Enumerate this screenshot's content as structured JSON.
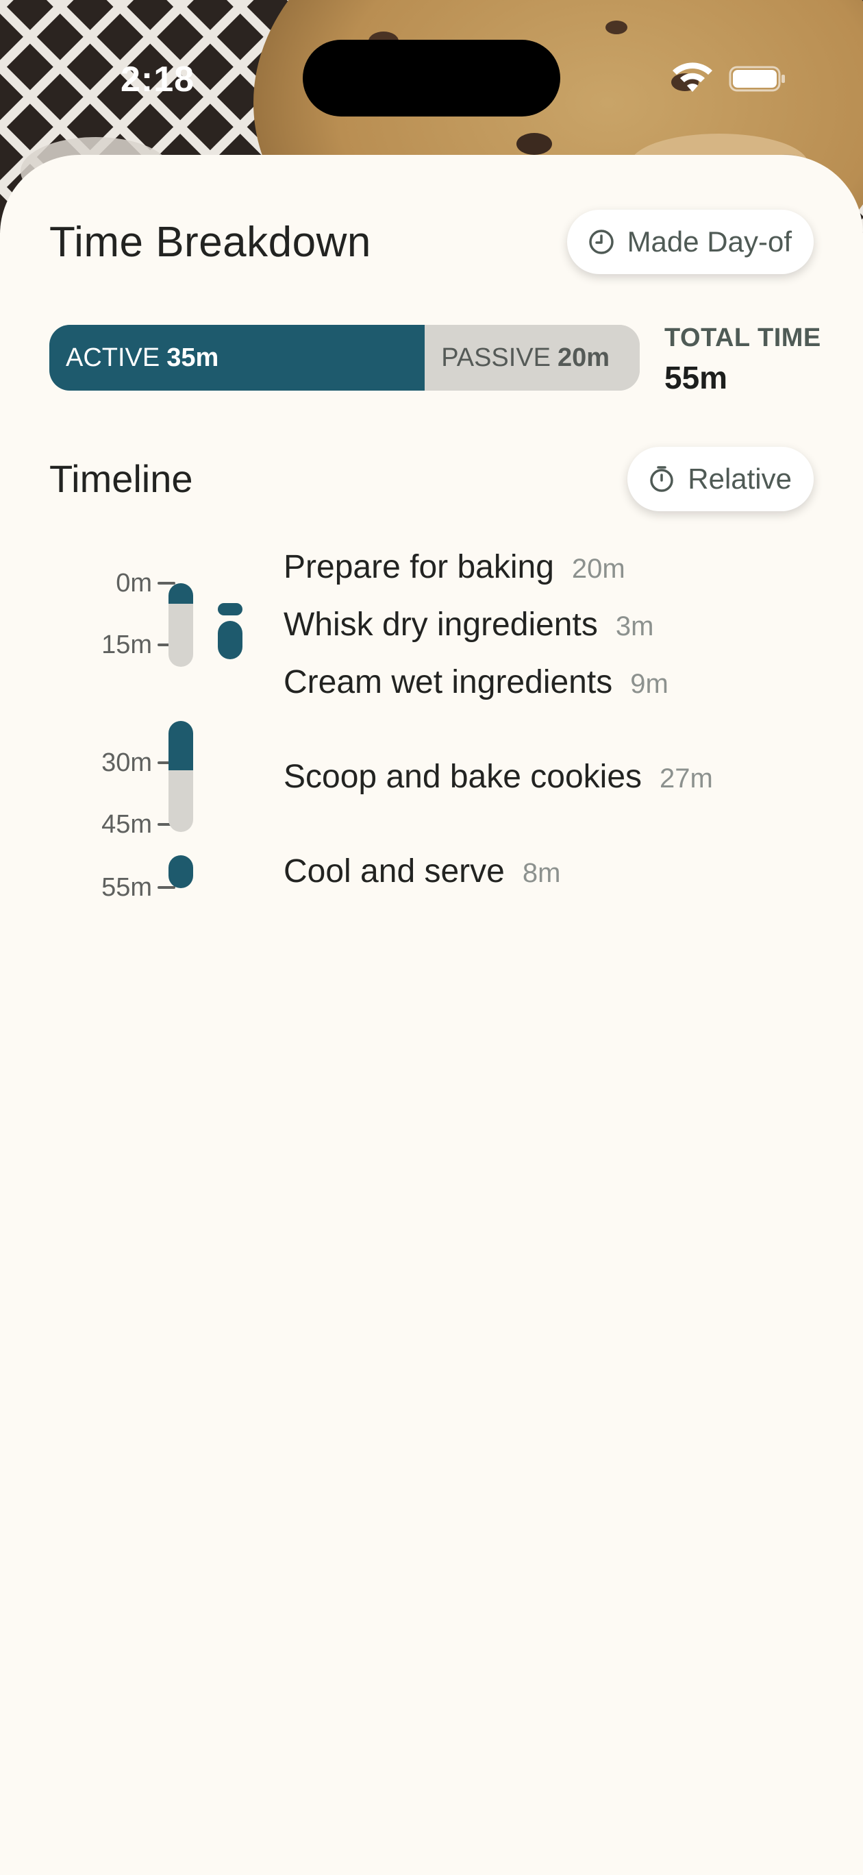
{
  "status_bar": {
    "time": "2:18",
    "icons": [
      "wifi-icon",
      "battery-icon"
    ]
  },
  "sheet": {
    "title": "Time Breakdown",
    "made_dayof_button": {
      "label": "Made Day-of",
      "icon": "clock-icon"
    },
    "time_bar": {
      "active_label": "ACTIVE",
      "active_value": "35m",
      "passive_label": "PASSIVE",
      "passive_value": "20m",
      "active_fraction": 0.636
    },
    "total_time": {
      "label": "TOTAL TIME",
      "value": "55m"
    },
    "timeline": {
      "heading": "Timeline",
      "mode_button": {
        "label": "Relative",
        "icon": "stopwatch-icon"
      },
      "ticks": [
        "0m",
        "15m",
        "30m",
        "45m",
        "55m"
      ],
      "steps": [
        {
          "name": "Prepare for baking",
          "duration": "20m"
        },
        {
          "name": "Whisk dry ingredients",
          "duration": "3m"
        },
        {
          "name": "Cream wet ingredients",
          "duration": "9m"
        },
        {
          "name": "Scoop and bake cookies",
          "duration": "27m"
        },
        {
          "name": "Cool and serve",
          "duration": "8m"
        }
      ]
    }
  },
  "colors": {
    "active": "#1e5a6d",
    "passive": "#d6d4cf",
    "sheet_background": "#fdfaf4"
  }
}
